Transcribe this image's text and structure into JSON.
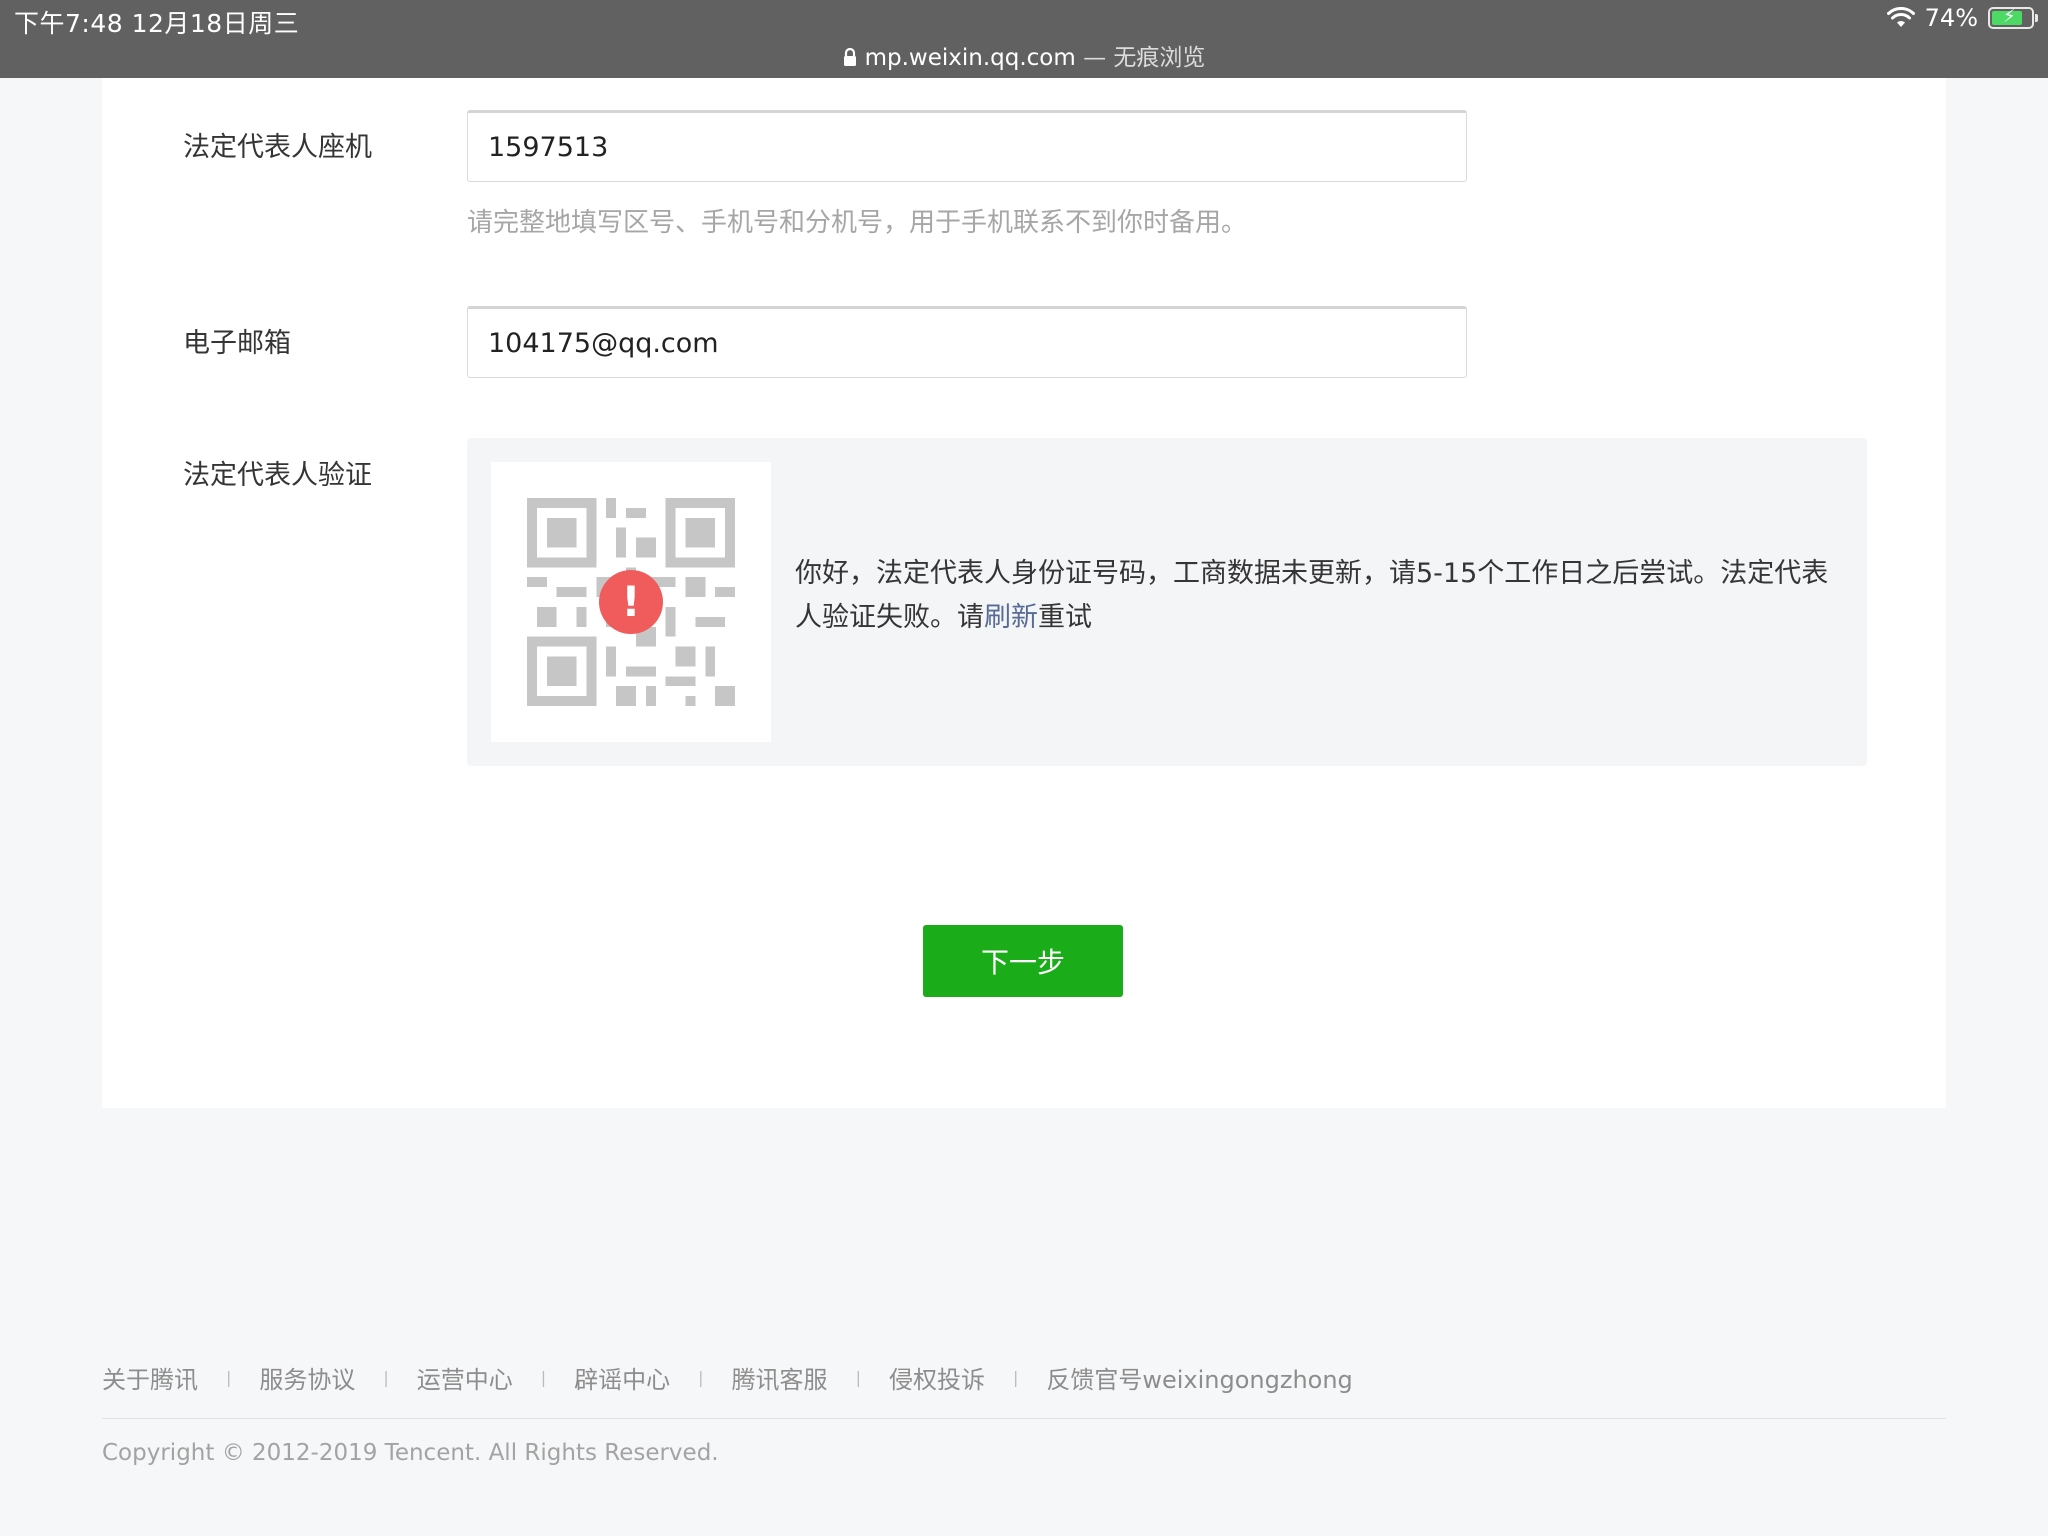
{
  "status_bar": {
    "time_date": "下午7:48   12月18日周三",
    "battery": "74%"
  },
  "url_bar": {
    "url": "mp.weixin.qq.com",
    "mode": " — 无痕浏览"
  },
  "form": {
    "landline": {
      "label": "法定代表人座机",
      "value": "1597513",
      "hint": "请完整地填写区号、手机号和分机号，用于手机联系不到你时备用。"
    },
    "email": {
      "label": "电子邮箱",
      "value": "104175@qq.com"
    },
    "verification": {
      "label": "法定代表人验证",
      "message_before": "你好，法定代表人身份证号码，工商数据未更新，请5-15个工作日之后尝试。法定代表人验证失败。请",
      "link": "刷新",
      "message_after": "重试"
    },
    "next_button": "下一步"
  },
  "footer": {
    "links": [
      "关于腾讯",
      "服务协议",
      "运营中心",
      "辟谣中心",
      "腾讯客服",
      "侵权投诉",
      "反馈官号weixingongzhong"
    ],
    "separator": "|",
    "copyright": "Copyright © 2012-2019 Tencent. All Rights Reserved."
  },
  "colors": {
    "primary_button": "#1aad19",
    "link": "#576b95",
    "error": "#f05b5b",
    "top_bar": "#616161"
  }
}
